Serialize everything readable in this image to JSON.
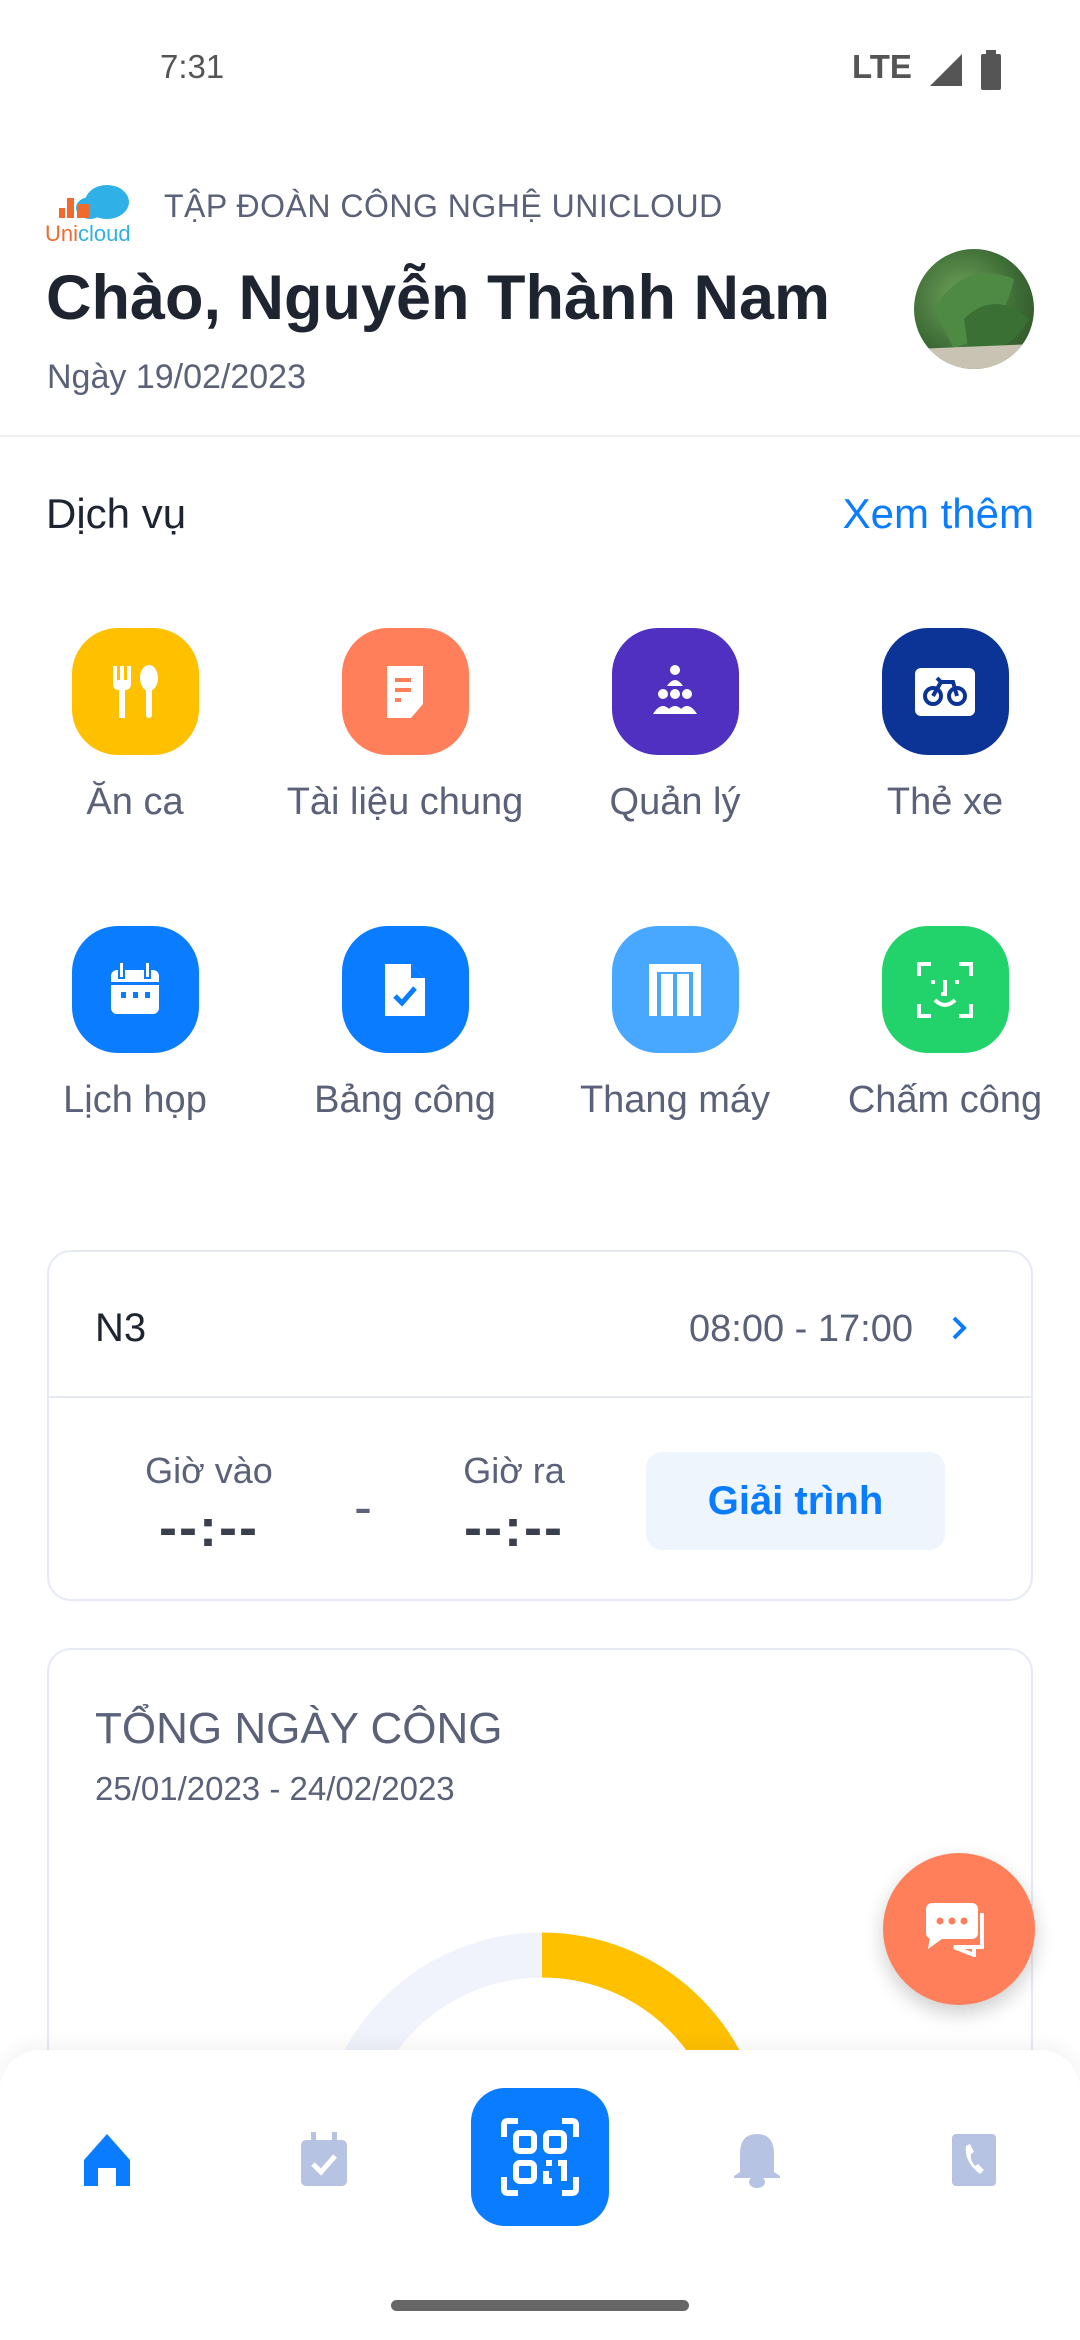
{
  "status_bar": {
    "time": "7:31",
    "network": "LTE"
  },
  "header": {
    "logo_text": "Unicloud",
    "company": "TẬP ĐOÀN CÔNG NGHỆ UNICLOUD",
    "greeting": "Chào, Nguyễn Thành Nam",
    "date": "Ngày 19/02/2023"
  },
  "services": {
    "title": "Dịch vụ",
    "more": "Xem thêm",
    "items": [
      {
        "label": "Ăn ca",
        "icon": "fork-spoon-icon",
        "color": "#ffc000"
      },
      {
        "label": "Tài liệu chung",
        "icon": "document-icon",
        "color": "#ff7f5a"
      },
      {
        "label": "Quản lý",
        "icon": "group-icon",
        "color": "#5030c0"
      },
      {
        "label": "Thẻ xe",
        "icon": "bicycle-card-icon",
        "color": "#0c3396"
      },
      {
        "label": "Lịch họp",
        "icon": "calendar-icon",
        "color": "#0a7cff"
      },
      {
        "label": "Bảng công",
        "icon": "file-check-icon",
        "color": "#0a7cff"
      },
      {
        "label": "Thang máy",
        "icon": "elevator-icon",
        "color": "#48a8ff"
      },
      {
        "label": "Chấm công",
        "icon": "face-scan-icon",
        "color": "#21d36a"
      }
    ]
  },
  "shift": {
    "name": "N3",
    "hours": "08:00 - 17:00",
    "check_in_label": "Giờ vào",
    "check_in": "--:--",
    "separator": "-",
    "check_out_label": "Giờ ra",
    "check_out": "--:--",
    "explain_button": "Giải trình"
  },
  "summary": {
    "title": "TỔNG NGÀY CÔNG",
    "range": "25/01/2023 - 24/02/2023",
    "gauge_color": "#ffc000"
  },
  "nav": {
    "items": [
      "home-icon",
      "calendar-check-icon",
      "qr-scan-icon",
      "bell-icon",
      "contacts-phone-icon"
    ],
    "active": "home-icon",
    "accent": "#0a7cff"
  }
}
